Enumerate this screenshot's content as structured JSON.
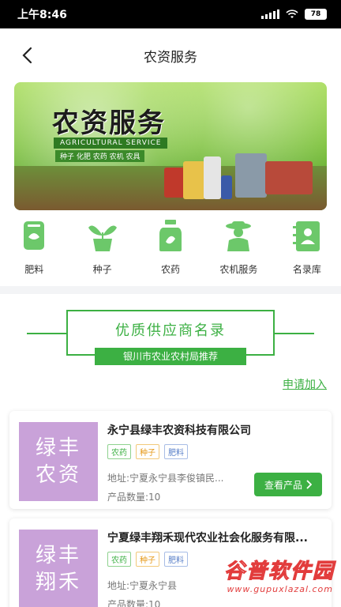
{
  "status_bar": {
    "time": "上午8:46",
    "battery": "78"
  },
  "nav": {
    "title": "农资服务"
  },
  "banner": {
    "title": "农资服务",
    "subtitle": "AGRICULTURAL SERVICE",
    "tags": "种子 化肥 农药 农机 农具"
  },
  "categories": [
    {
      "label": "肥料",
      "icon": "fertilizer-icon"
    },
    {
      "label": "种子",
      "icon": "seedling-icon"
    },
    {
      "label": "农药",
      "icon": "pesticide-icon"
    },
    {
      "label": "农机服务",
      "icon": "farmer-icon"
    },
    {
      "label": "名录库",
      "icon": "contact-book-icon"
    }
  ],
  "supplier": {
    "title": "优质供应商名录",
    "subtitle": "银川市农业农村局推荐",
    "apply": "申请加入"
  },
  "companies": [
    {
      "logo_line1": "绿丰",
      "logo_line2": "农资",
      "name": "永宁县绿丰农资科技有限公司",
      "tags": [
        "农药",
        "种子",
        "肥料"
      ],
      "address": "地址:宁夏永宁县李俊镇民...",
      "count": "产品数量:10",
      "button": "查看产品"
    },
    {
      "logo_line1": "绿丰",
      "logo_line2": "翔禾",
      "name": "宁夏绿丰翔禾现代农业社会化服务有限...",
      "tags": [
        "农药",
        "种子",
        "肥料"
      ],
      "address": "地址:宁夏永宁县",
      "count": "产品数量:10",
      "button": "查看产品"
    }
  ],
  "watermark": {
    "text": "谷普软件园",
    "url": "www.gupuxlazal.com"
  },
  "colors": {
    "accent": "#3cb043",
    "logo_bg": "#c9a2d9"
  }
}
